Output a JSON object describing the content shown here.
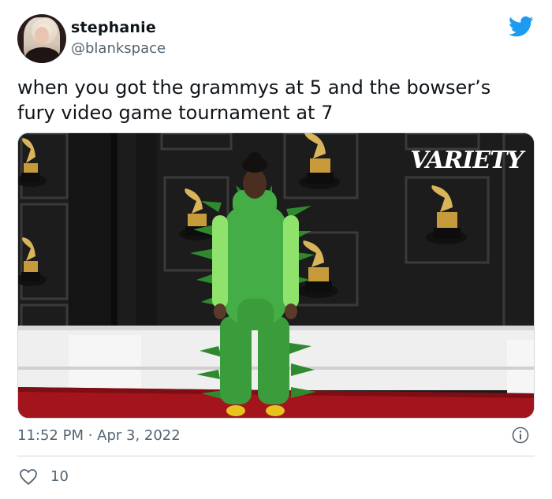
{
  "tweet": {
    "display_name": "stephanie",
    "handle": "@blankspace",
    "text": "when you got the grammys at 5 and the bowser’s fury video game tournament at 7",
    "timestamp": "11:52 PM · Apr 3, 2022",
    "like_count": "10",
    "brand_color": "#1d9bf0"
  },
  "media": {
    "watermark": "VARIETY"
  },
  "icons": {
    "twitter": "twitter-bird-icon",
    "info": "info-icon",
    "like": "heart-icon"
  }
}
